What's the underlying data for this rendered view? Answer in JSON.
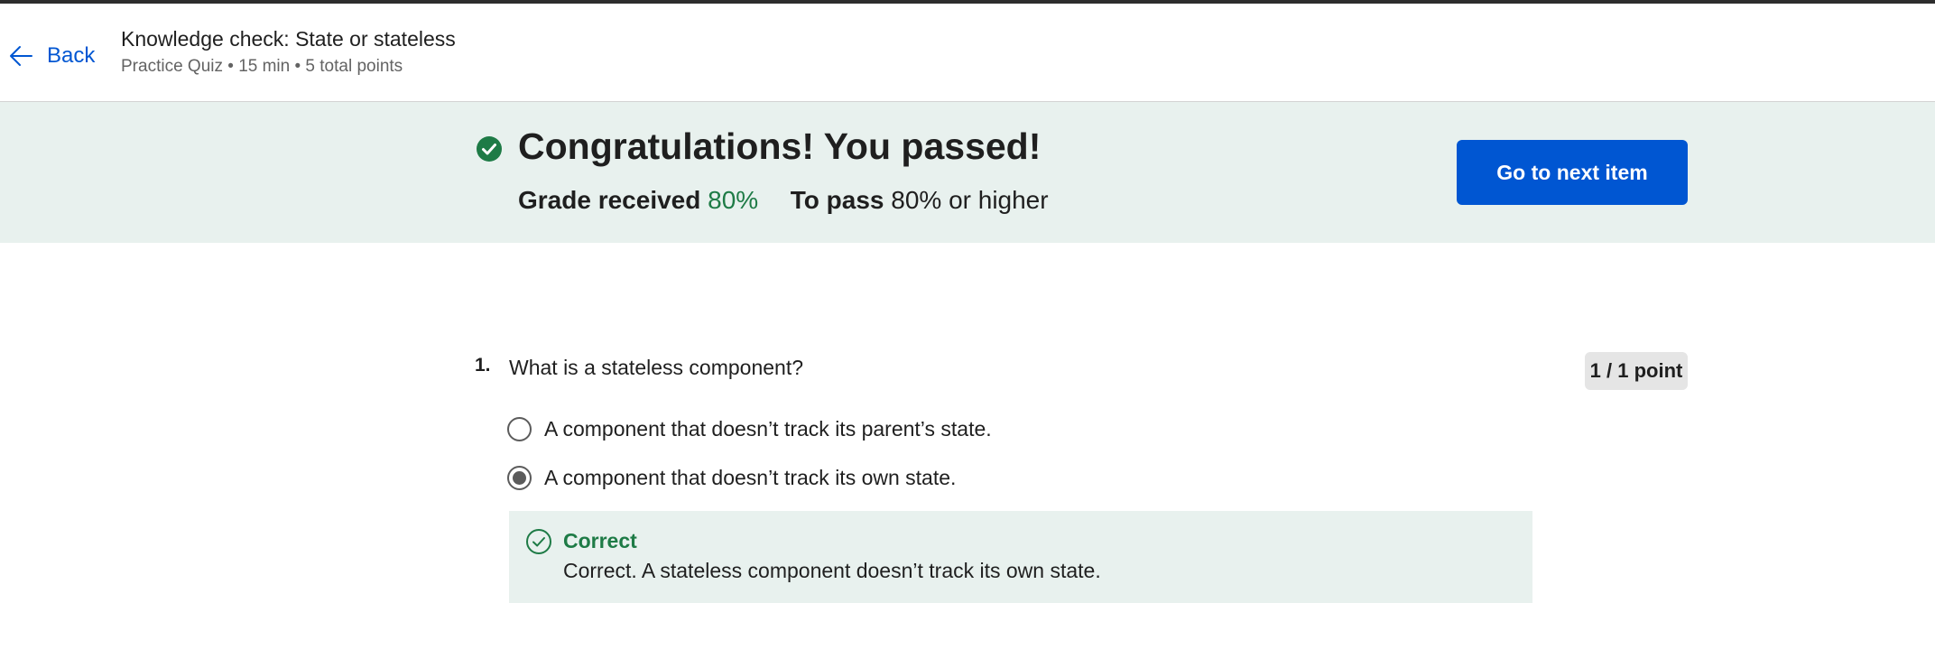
{
  "header": {
    "back_label": "Back",
    "title": "Knowledge check: State or stateless",
    "subtitle": "Practice Quiz • 15 min • 5 total points"
  },
  "banner": {
    "title": "Congratulations! You passed!",
    "grade_label": "Grade received",
    "grade_value": "80%",
    "pass_label": "To pass",
    "pass_value": "80% or higher",
    "next_button": "Go to next item",
    "status_icon": "check-circle-icon"
  },
  "question": {
    "number": "1.",
    "text": "What is a stateless component?",
    "points": "1 / 1 point",
    "options": [
      {
        "label": "A component that doesn’t track its parent’s state.",
        "selected": false
      },
      {
        "label": "A component that doesn’t track its own state.",
        "selected": true
      }
    ],
    "feedback": {
      "title": "Correct",
      "text": "Correct. A stateless component doesn’t track its own state.",
      "icon": "check-circle-outline-icon"
    }
  },
  "colors": {
    "accent": "#0056d2",
    "success": "#1e7b46",
    "banner_bg": "#e8f1ee"
  }
}
